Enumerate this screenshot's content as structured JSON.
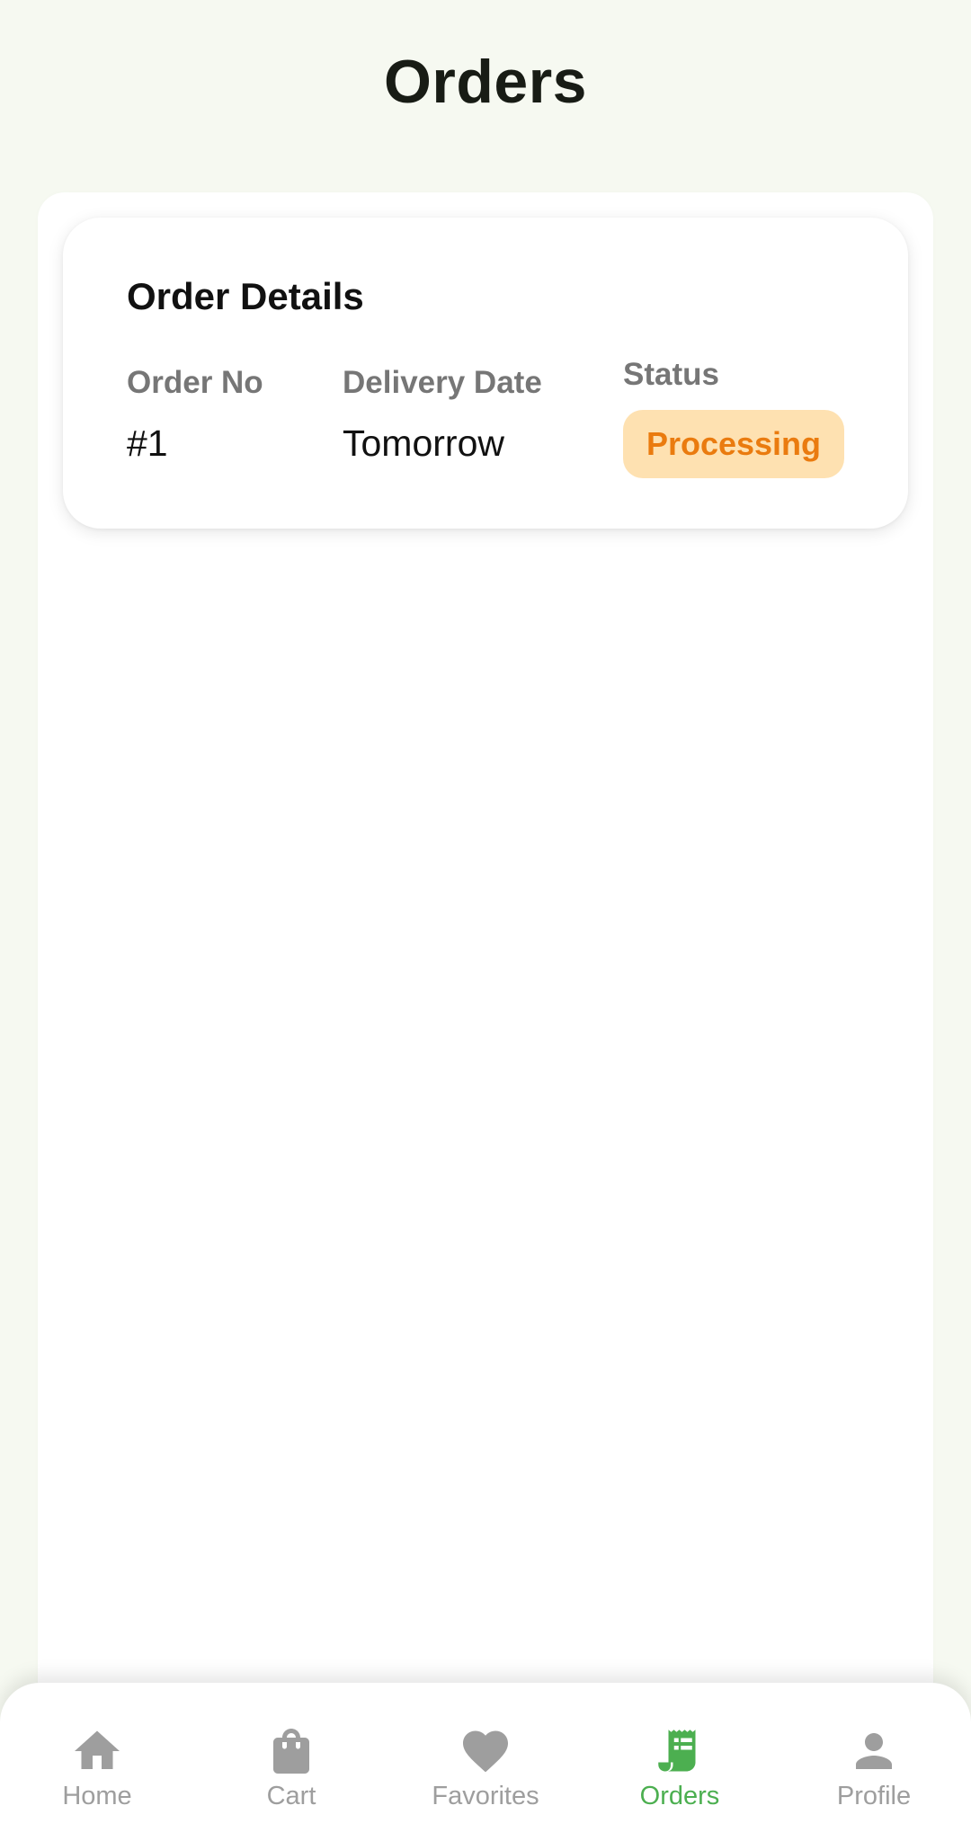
{
  "header": {
    "title": "Orders"
  },
  "order_card": {
    "title": "Order Details",
    "order_no_label": "Order No",
    "order_no_value": "#1",
    "delivery_date_label": "Delivery Date",
    "delivery_date_value": "Tomorrow",
    "status_label": "Status",
    "status_value": "Processing"
  },
  "bottom_nav": {
    "items": [
      {
        "label": "Home",
        "icon": "home-icon",
        "active": false
      },
      {
        "label": "Cart",
        "icon": "shopping-bag-icon",
        "active": false
      },
      {
        "label": "Favorites",
        "icon": "heart-icon",
        "active": false
      },
      {
        "label": "Orders",
        "icon": "receipt-icon",
        "active": true
      },
      {
        "label": "Profile",
        "icon": "person-icon",
        "active": false
      }
    ]
  },
  "colors": {
    "background": "#f6f9f1",
    "accent_active": "#4caf50",
    "inactive": "#9e9e9e",
    "status_bg": "#fee1b1",
    "status_text": "#ea7b0f"
  }
}
